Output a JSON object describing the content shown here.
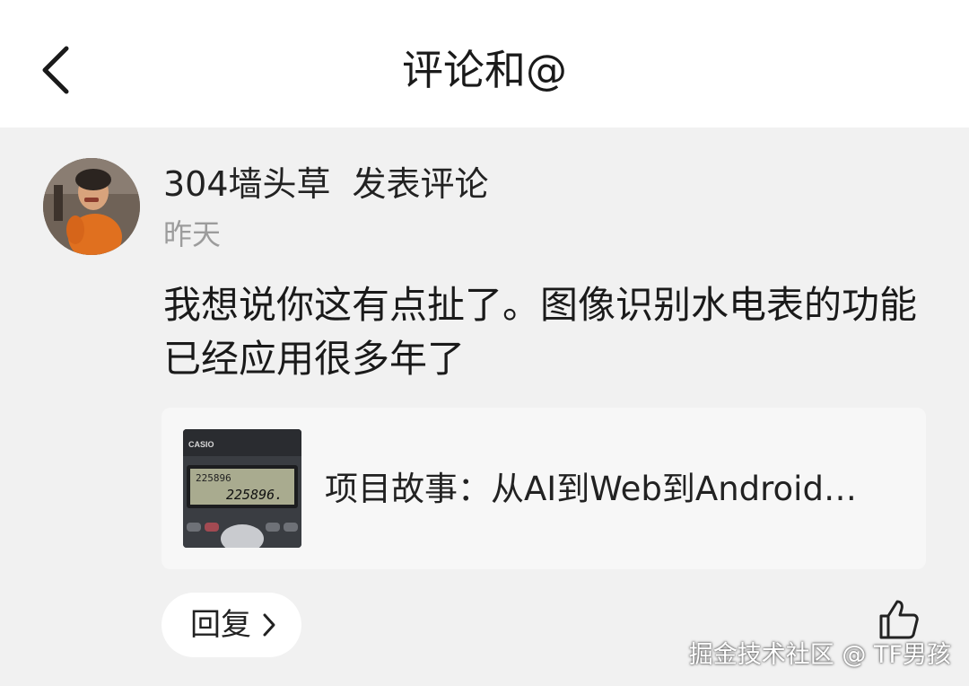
{
  "header": {
    "title": "评论和@",
    "back_icon": "chevron-left-icon"
  },
  "comment_item": {
    "username": "304墙头草",
    "action": "发表评论",
    "time": "昨天",
    "text": "我想说你这有点扯了。图像识别水电表的功能已经应用很多年了",
    "card": {
      "title": "项目故事：从AI到Web到Android…",
      "thumb": {
        "brand": "CASIO",
        "display_line_1": "225896",
        "display_line_2": "225896."
      }
    },
    "reply": {
      "label": "回复"
    },
    "like_icon": "thumbs-up-icon"
  },
  "watermark": "掘金技术社区 @ TF男孩",
  "colors": {
    "background": "#f1f1f1",
    "header_bg": "#ffffff",
    "card_bg": "#f7f7f7",
    "secondary_text": "#9c9c9c"
  }
}
